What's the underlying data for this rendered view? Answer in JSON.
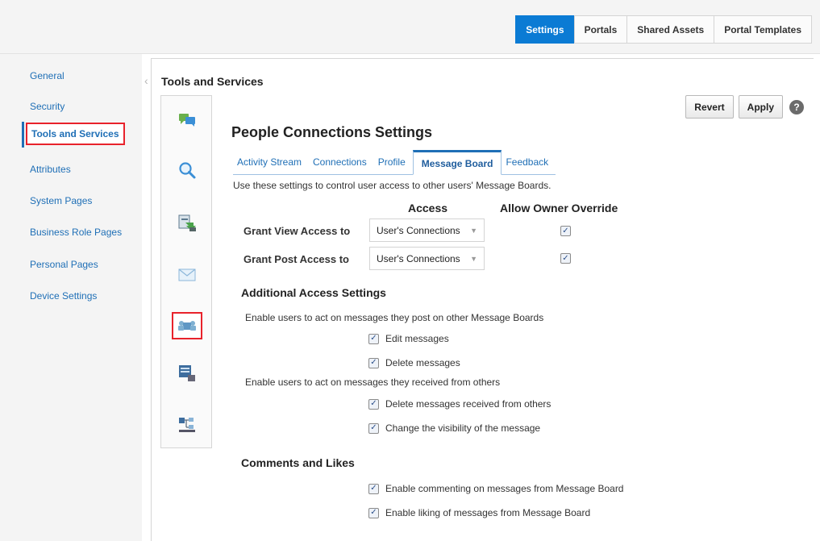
{
  "top_tabs": [
    "Settings",
    "Portals",
    "Shared Assets",
    "Portal Templates"
  ],
  "left_nav": [
    "General",
    "Security",
    "Tools and Services",
    "Attributes",
    "System Pages",
    "Business Role Pages",
    "Personal Pages",
    "Device Settings"
  ],
  "panel_title": "Tools and Services",
  "actions": {
    "revert": "Revert",
    "apply": "Apply",
    "help": "?"
  },
  "section_title": "People Connections Settings",
  "subtabs": [
    "Activity Stream",
    "Connections",
    "Profile",
    "Message Board",
    "Feedback"
  ],
  "subtab_description": "Use these settings to control user access to other users' Message Boards.",
  "access_table": {
    "col_access": "Access",
    "col_override": "Allow Owner Override",
    "rows": [
      {
        "label": "Grant View Access to",
        "value": "User's Connections",
        "override": true
      },
      {
        "label": "Grant Post Access to",
        "value": "User's Connections",
        "override": true
      }
    ]
  },
  "additional": {
    "title": "Additional Access Settings",
    "desc_post": "Enable users to act on messages they post on other Message Boards",
    "edit": "Edit messages",
    "delete": "Delete messages",
    "desc_received": "Enable users to act on messages they received from others",
    "delete_received": "Delete messages received from others",
    "visibility": "Change the visibility of the message"
  },
  "comments": {
    "title": "Comments and Likes",
    "commenting": "Enable commenting on messages from Message Board",
    "liking": "Enable liking of messages from Message Board"
  },
  "checkmark": "✓",
  "colors": {
    "accent": "#0b7bd4",
    "link": "#1f6fb6",
    "highlight": "#e8222b"
  }
}
